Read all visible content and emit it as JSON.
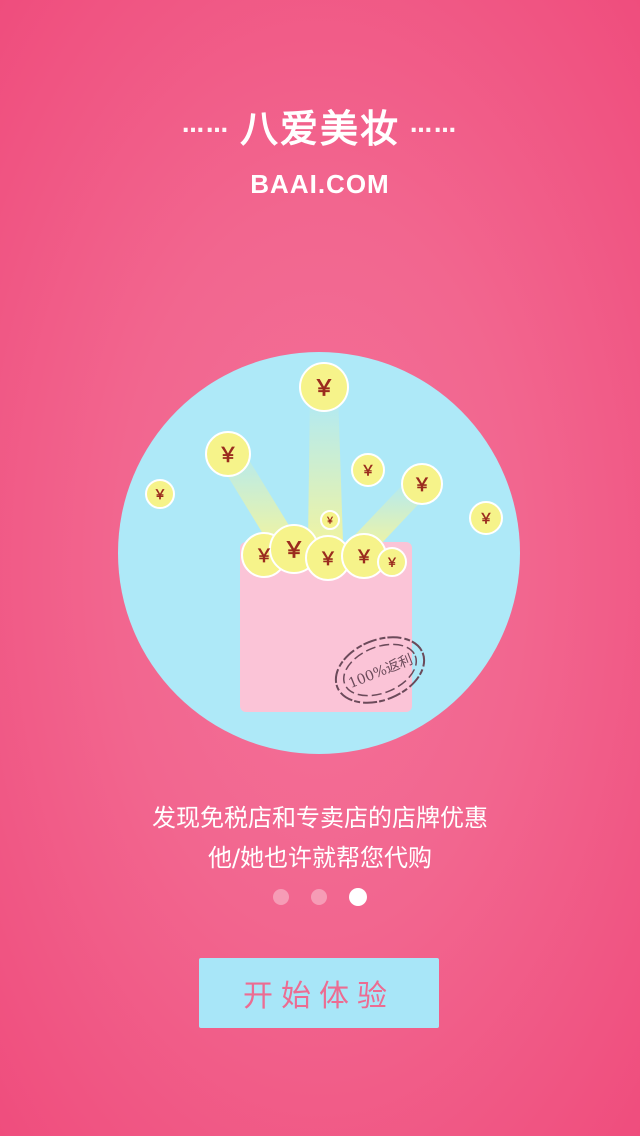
{
  "header": {
    "title": "八爱美妆",
    "domain": "BAAI.COM",
    "decor_dots": "……"
  },
  "illustration": {
    "coin_symbol": "￥",
    "stamp_text": "100%返利",
    "circle_color": "#aee9f8",
    "wallet_color": "#fbc4d7"
  },
  "caption": {
    "line1": "发现免税店和专卖店的店牌优惠",
    "line2": "他/她也许就帮您代购"
  },
  "pager": {
    "count": 3,
    "active_index": 2
  },
  "cta": {
    "label": "开始体验"
  }
}
